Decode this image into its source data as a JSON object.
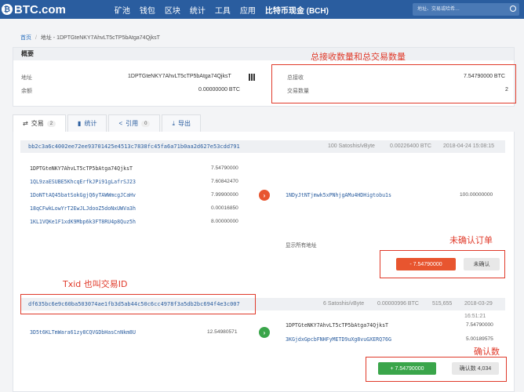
{
  "header": {
    "logo": "BTC.com",
    "nav": [
      "矿池",
      "钱包",
      "区块",
      "统计",
      "工具",
      "应用",
      "比特币现金 (BCH)"
    ],
    "search_placeholder": "地址、交易或哈希…"
  },
  "breadcrumb": {
    "home": "首页",
    "sep": "/",
    "current": "地址 - 1DPTGteNKY7AhvLT5cTP5bAtga74QjksT"
  },
  "overview": {
    "title": "概要",
    "address_label": "地址",
    "address_value": "1DPTGteNKY7AhvLT5cTP5bAtga74QjksT",
    "balance_label": "余额",
    "balance_value": "0.00000000 BTC",
    "received_label": "总接收",
    "received_value": "7.54790000 BTC",
    "tx_count_label": "交易数量",
    "tx_count_value": "2"
  },
  "annotations": {
    "total": "总接收数量和总交易数量",
    "unconfirmed": "未确认订单",
    "txid": "Txid 也叫交易ID",
    "confirmations": "确认数"
  },
  "tabs": [
    {
      "label": "交易",
      "count": "2",
      "icon": "swap-icon"
    },
    {
      "label": "统计",
      "icon": "bar-chart-icon"
    },
    {
      "label": "引用",
      "count": "0",
      "icon": "share-icon"
    },
    {
      "label": "导出",
      "icon": "download-icon"
    }
  ],
  "tx1": {
    "hash": "bb2c3a6c4002ee72ee93701425e4513c7838fc45fa6a71b0aa2d627e53cdd791",
    "fee_rate": "100 Satoshis/vByte",
    "fee": "0.00226400 BTC",
    "time": "2018-04-24 15:08:15",
    "inputs": [
      {
        "address": "1DPTGteNKY7AhvLT5cTP5bAtga74QjksT",
        "amount": "7.54790000"
      },
      {
        "address": "1QL9zaESUBE5KhcqErfkJPi91gLafrSJ23",
        "amount": "7.60842470"
      },
      {
        "address": "1DoNTtAQ45batSokGgjQ6yTAWWmcgJCaHv",
        "amount": "7.99900000"
      },
      {
        "address": "18qCFwkLowYrT2EwJLJdooZ5doNxUWVa3h",
        "amount": "0.00016850"
      },
      {
        "address": "1KL1VQKe1F1xdK9Mbp6k3FT8RU4p8Quz5h",
        "amount": "8.00000000"
      }
    ],
    "output_address": "1NDyJtNTjmwk5xPNhjgAMu4HDHigtobu1s",
    "output_amount": "100.00000000",
    "show_all": "显示所有地址",
    "delta": "- 7.54790000",
    "status": "未确认"
  },
  "tx2": {
    "hash": "df635bc6e9c60ba503074ae1fb3d5ab44c50c6cc4978f3a5db2bc694f4e3c007",
    "fee_rate": "6 Satoshis/vByte",
    "fee": "0.00000996 BTC",
    "block": "515,655",
    "time": "2018-03-29 16:51:21",
    "input_address": "3D5t6KLTmWara61zy8CQVGDbHasCnNkm8U",
    "input_amount": "12.54980571",
    "outputs": [
      {
        "address": "1DPTGteNKY7AhvLT5cTP5bAtga74QjksT",
        "amount": "7.54790000"
      },
      {
        "address": "3KGjdxGpcbFNHFyMETD9uXg8vuGXERQ76G",
        "amount": "5.00189575"
      }
    ],
    "delta": "+ 7.54790000",
    "confirmations": "确认数 4,034"
  },
  "colors": {
    "brand": "#2a5d9f",
    "annotation": "#e03a2a",
    "out": "#e8552f",
    "in": "#3aa54a"
  }
}
